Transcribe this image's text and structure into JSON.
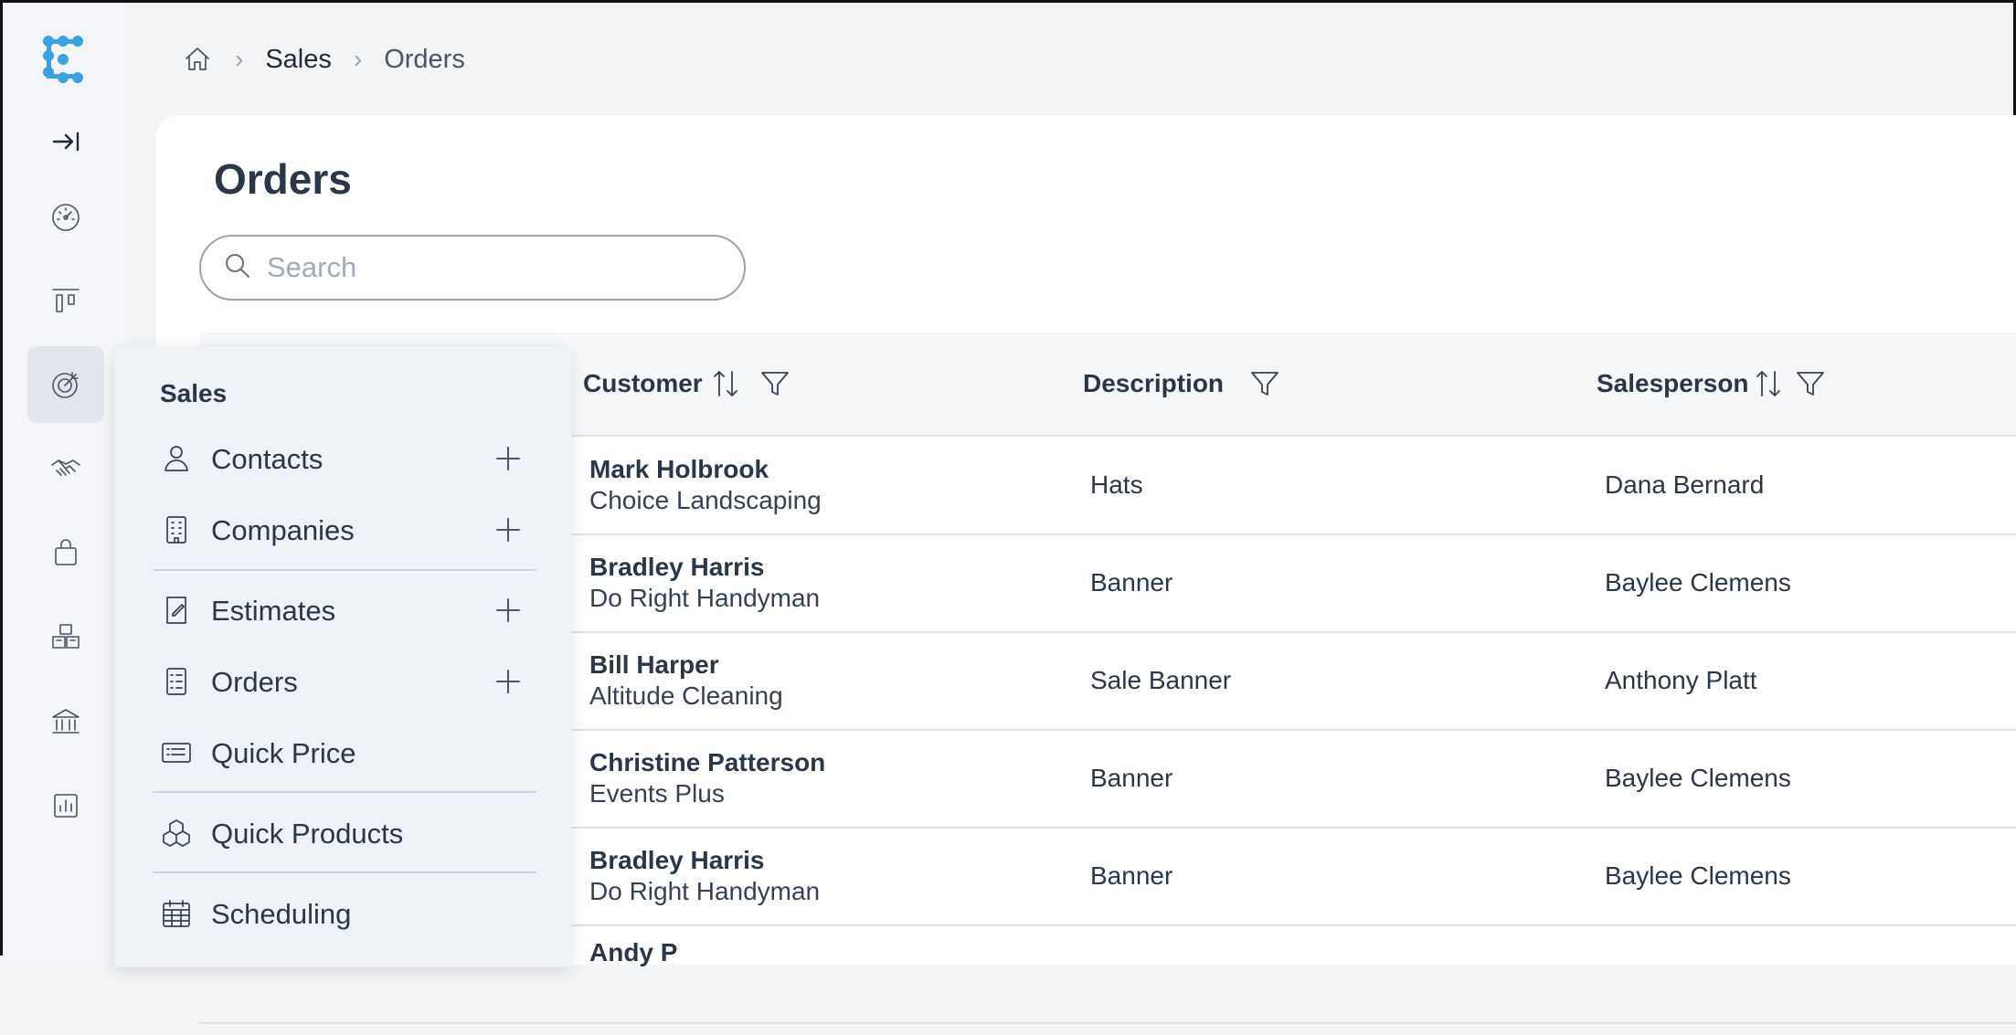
{
  "breadcrumb": {
    "home_icon": "home-icon",
    "section": "Sales",
    "current": "Orders"
  },
  "page": {
    "title": "Orders"
  },
  "search": {
    "placeholder": "Search",
    "value": ""
  },
  "rail": {
    "items": [
      "collapse-icon",
      "dashboard-icon",
      "board-icon",
      "target-icon",
      "handshake-icon",
      "bag-icon",
      "boxes-icon",
      "bank-icon",
      "chart-icon"
    ],
    "active": "target-icon"
  },
  "table": {
    "columns": [
      {
        "label": "Customer",
        "sortable": true,
        "filterable": true
      },
      {
        "label": "Description",
        "sortable": false,
        "filterable": true
      },
      {
        "label": "Salesperson",
        "sortable": true,
        "filterable": true
      }
    ],
    "rows": [
      {
        "customer": "Mark Holbrook",
        "company": "Choice Landscaping",
        "description": "Hats",
        "salesperson": "Dana Bernard"
      },
      {
        "customer": "Bradley Harris",
        "company": "Do Right Handyman",
        "description": "Banner",
        "salesperson": "Baylee Clemens"
      },
      {
        "customer": "Bill Harper",
        "company": "Altitude Cleaning",
        "description": "Sale Banner",
        "salesperson": "Anthony Platt"
      },
      {
        "customer": "Christine Patterson",
        "company": "Events Plus",
        "description": "Banner",
        "salesperson": "Baylee Clemens"
      },
      {
        "customer": "Bradley Harris",
        "company": "Do Right Handyman",
        "description": "Banner",
        "salesperson": "Baylee Clemens"
      },
      {
        "customer": "Andy P",
        "company": "",
        "description": "",
        "salesperson": ""
      }
    ]
  },
  "menu": {
    "title": "Sales",
    "items": [
      {
        "label": "Contacts",
        "icon": "person-icon",
        "add": true
      },
      {
        "label": "Companies",
        "icon": "building-icon",
        "add": true
      },
      {
        "label": "Estimates",
        "icon": "estimate-icon",
        "add": true
      },
      {
        "label": "Orders",
        "icon": "orders-icon",
        "add": true
      },
      {
        "label": "Quick Price",
        "icon": "price-card-icon",
        "add": false
      },
      {
        "label": "Quick Products",
        "icon": "cubes-icon",
        "add": false
      },
      {
        "label": "Scheduling",
        "icon": "calendar-icon",
        "add": false
      }
    ]
  },
  "colors": {
    "accent": "#38a3e0",
    "text": "#2b3646",
    "menu_bg": "#eef1f5"
  }
}
